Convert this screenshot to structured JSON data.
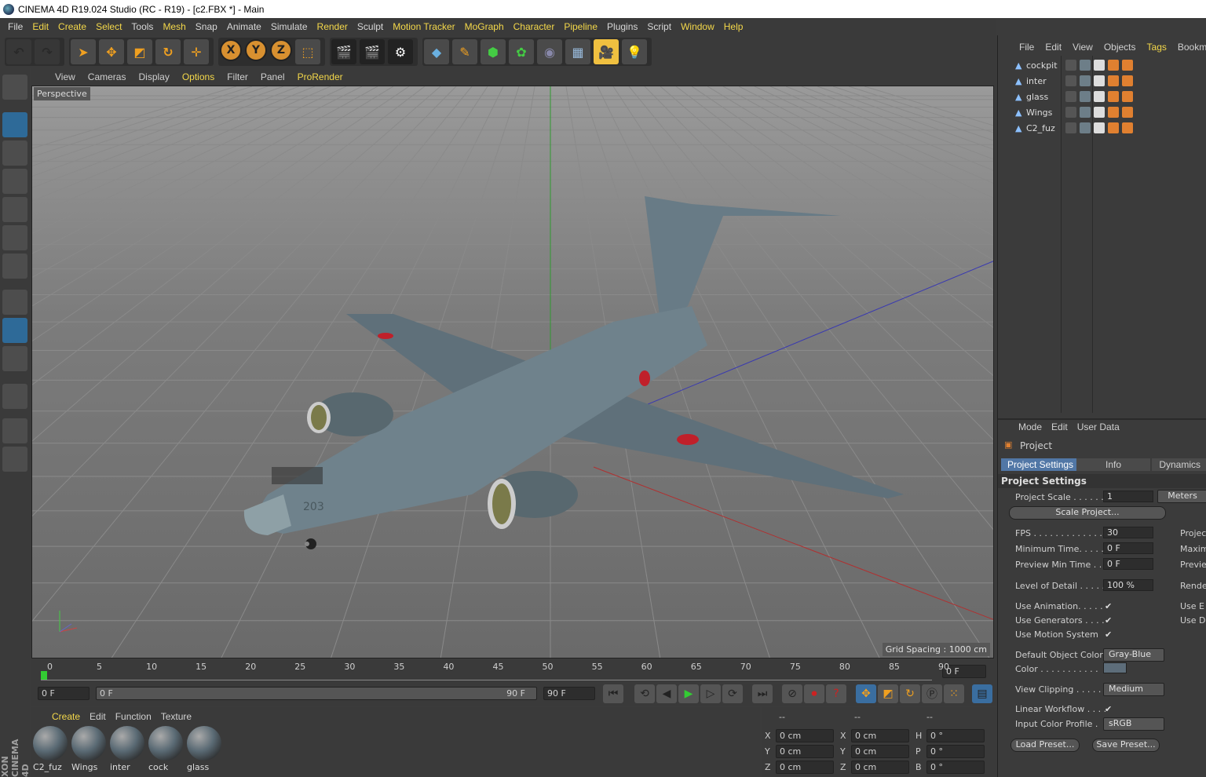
{
  "window": {
    "title": "CINEMA 4D R19.024 Studio (RC - R19) - [c2.FBX *] - Main"
  },
  "menu": [
    {
      "label": "File",
      "hl": false
    },
    {
      "label": "Edit",
      "hl": true
    },
    {
      "label": "Create",
      "hl": true
    },
    {
      "label": "Select",
      "hl": true
    },
    {
      "label": "Tools",
      "hl": false
    },
    {
      "label": "Mesh",
      "hl": true
    },
    {
      "label": "Snap",
      "hl": false
    },
    {
      "label": "Animate",
      "hl": false
    },
    {
      "label": "Simulate",
      "hl": false
    },
    {
      "label": "Render",
      "hl": true
    },
    {
      "label": "Sculpt",
      "hl": false
    },
    {
      "label": "Motion Tracker",
      "hl": true
    },
    {
      "label": "MoGraph",
      "hl": true
    },
    {
      "label": "Character",
      "hl": true
    },
    {
      "label": "Pipeline",
      "hl": true
    },
    {
      "label": "Plugins",
      "hl": false
    },
    {
      "label": "Script",
      "hl": false
    },
    {
      "label": "Window",
      "hl": true
    },
    {
      "label": "Help",
      "hl": true
    }
  ],
  "toolbar": {
    "axis_x": "X",
    "axis_y": "Y",
    "axis_z": "Z"
  },
  "viewport": {
    "menu": [
      "View",
      "Cameras",
      "Display",
      "Options",
      "Filter",
      "Panel",
      "ProRender"
    ],
    "label": "Perspective",
    "grid_spacing": "Grid Spacing : 1000 cm",
    "aircraft_number": "203"
  },
  "timeline": {
    "ticks": [
      "0",
      "5",
      "10",
      "15",
      "20",
      "25",
      "30",
      "35",
      "40",
      "45",
      "50",
      "55",
      "60",
      "65",
      "70",
      "75",
      "80",
      "85",
      "90"
    ],
    "current_frame": "0 F",
    "start": "0 F",
    "range_start": "0 F",
    "range_end": "90 F",
    "end": "90 F"
  },
  "materials": {
    "tabs": [
      "Create",
      "Edit",
      "Function",
      "Texture"
    ],
    "items": [
      "C2_fuz",
      "Wings",
      "inter",
      "cock",
      "glass"
    ]
  },
  "coords": {
    "headers": [
      "--",
      "--",
      "--"
    ],
    "rows": [
      {
        "a": "X",
        "av": "0 cm",
        "b": "X",
        "bv": "0 cm",
        "c": "H",
        "cv": "0 °"
      },
      {
        "a": "Y",
        "av": "0 cm",
        "b": "Y",
        "bv": "0 cm",
        "c": "P",
        "cv": "0 °"
      },
      {
        "a": "Z",
        "av": "0 cm",
        "b": "Z",
        "bv": "0 cm",
        "c": "B",
        "cv": "0 °"
      }
    ]
  },
  "objects": {
    "menu": [
      "File",
      "Edit",
      "View",
      "Objects",
      "Tags",
      "Bookmar"
    ],
    "items": [
      "cockpit",
      "inter",
      "glass",
      "Wings",
      "C2_fuz"
    ]
  },
  "attributes": {
    "menu": [
      "Mode",
      "Edit",
      "User Data"
    ],
    "object": "Project",
    "tabs": [
      "Project Settings",
      "Info",
      "Dynamics"
    ],
    "section": "Project Settings",
    "project_scale_label": "Project Scale . . . . . .",
    "project_scale": "1",
    "project_scale_unit": "Meters",
    "scale_project_btn": "Scale Project...",
    "fps_label": "FPS . . . . . . . . . . . . . .",
    "fps": "30",
    "min_time_label": "Minimum Time. . . . .",
    "min_time": "0 F",
    "preview_min_label": "Preview Min Time . .",
    "preview_min": "0 F",
    "lod_label": "Level of Detail . . . . .",
    "lod": "100 %",
    "use_anim_label": "Use Animation. . . . .",
    "use_gen_label": "Use Generators . . . .",
    "use_motion_label": "Use Motion System",
    "check": "✔",
    "default_color_label": "Default Object Color",
    "default_color": "Gray-Blue",
    "color_label": "Color . . . . . . . . . . .",
    "view_clip_label": "View Clipping . . . . .",
    "view_clip": "Medium",
    "linear_label": "Linear Workflow . . . .",
    "input_profile_label": "Input Color Profile .",
    "input_profile": "sRGB",
    "load_preset": "Load Preset...",
    "save_preset": "Save Preset...",
    "cut_right": [
      "Projec",
      "Maxim",
      "Previe",
      "Rende",
      "Use E",
      "Use D"
    ]
  },
  "brand": "XON CINEMA 4D"
}
